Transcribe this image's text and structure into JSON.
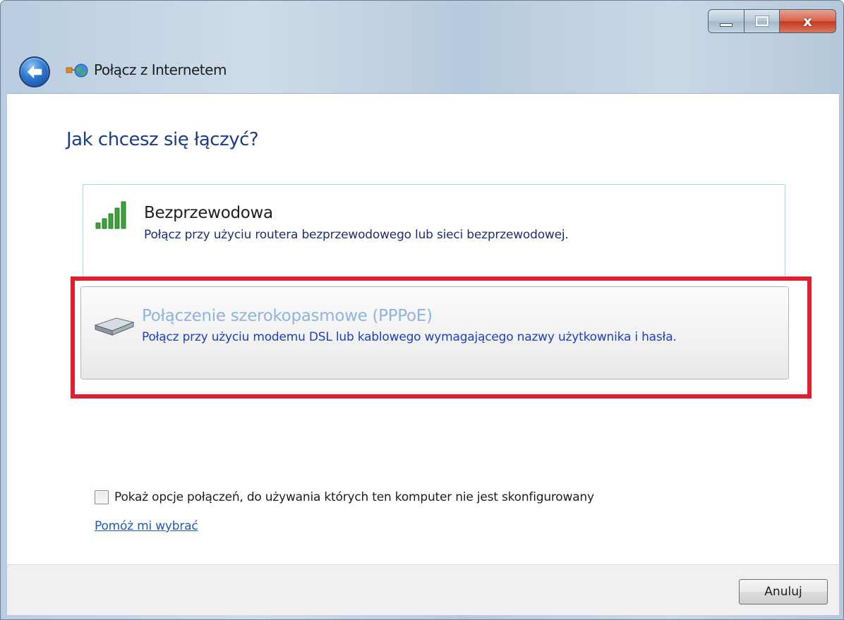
{
  "window": {
    "title": "Połącz z Internetem",
    "caption_buttons": {
      "minimize_icon": "minimize-icon",
      "maximize_icon": "maximize-icon",
      "close_label": "x"
    }
  },
  "page": {
    "heading": "Jak chcesz się łączyć?"
  },
  "options": [
    {
      "title": "Bezprzewodowa",
      "description": "Połącz przy użyciu routera bezprzewodowego lub sieci bezprzewodowej.",
      "icon": "signal-bars-icon"
    },
    {
      "title": "Połączenie szerokopasmowe (PPPoE)",
      "description": "Połącz przy użyciu modemu DSL lub kablowego wymagającego nazwy użytkownika i hasła.",
      "icon": "modem-icon",
      "highlighted": true
    }
  ],
  "show_options": {
    "label": "Pokaż opcje połączeń, do używania których ten komputer nie jest skonfigurowany",
    "checked": false
  },
  "help_link": "Pomóż mi wybrać",
  "footer": {
    "cancel_label": "Anuluj"
  },
  "colors": {
    "heading": "#1d3c8a",
    "highlight": "#e21d2d",
    "link": "#1c5ac4"
  }
}
